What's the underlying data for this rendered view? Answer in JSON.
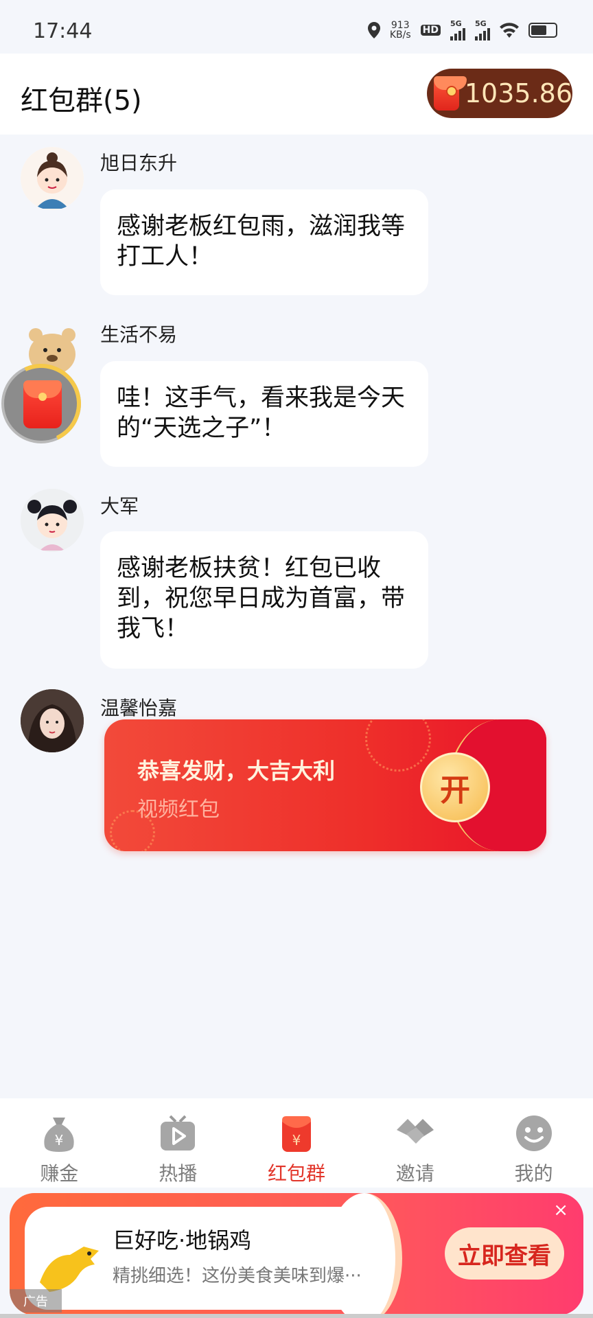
{
  "status_bar": {
    "time": "17:44",
    "speed_value": "913",
    "speed_unit": "KB/s",
    "hd_label": "HD",
    "net1": "5G",
    "net2": "5G"
  },
  "header": {
    "title": "红包群(5)",
    "balance": "1035.86"
  },
  "messages": [
    {
      "sender": "旭日东升",
      "text": "感谢老板红包雨，滋润我等打工人！"
    },
    {
      "sender": "生活不易",
      "text": "哇！这手气，看来我是今天的“天选之子”！"
    },
    {
      "sender": "大军",
      "text": "感谢老板扶贫！红包已收到，祝您早日成为首富，带我飞！"
    },
    {
      "sender": "温馨怡嘉"
    }
  ],
  "red_packet": {
    "title": "恭喜发财，大吉大利",
    "subtitle": "视频红包",
    "open_label": "开"
  },
  "bottom_nav": [
    {
      "label": "赚金",
      "icon": "money-bag-icon"
    },
    {
      "label": "热播",
      "icon": "play-icon"
    },
    {
      "label": "红包群",
      "icon": "red-envelope-icon",
      "active": true
    },
    {
      "label": "邀请",
      "icon": "handshake-icon"
    },
    {
      "label": "我的",
      "icon": "smiley-icon"
    }
  ],
  "ad": {
    "title": "巨好吃·地锅鸡",
    "description": "精挑细选！这份美食美味到爆···",
    "cta": "立即查看",
    "tag": "广告",
    "close": "×"
  },
  "colors": {
    "accent_red": "#e2352a",
    "balance_pill": "#6b2b17",
    "page_bg": "#f4f6fb"
  }
}
